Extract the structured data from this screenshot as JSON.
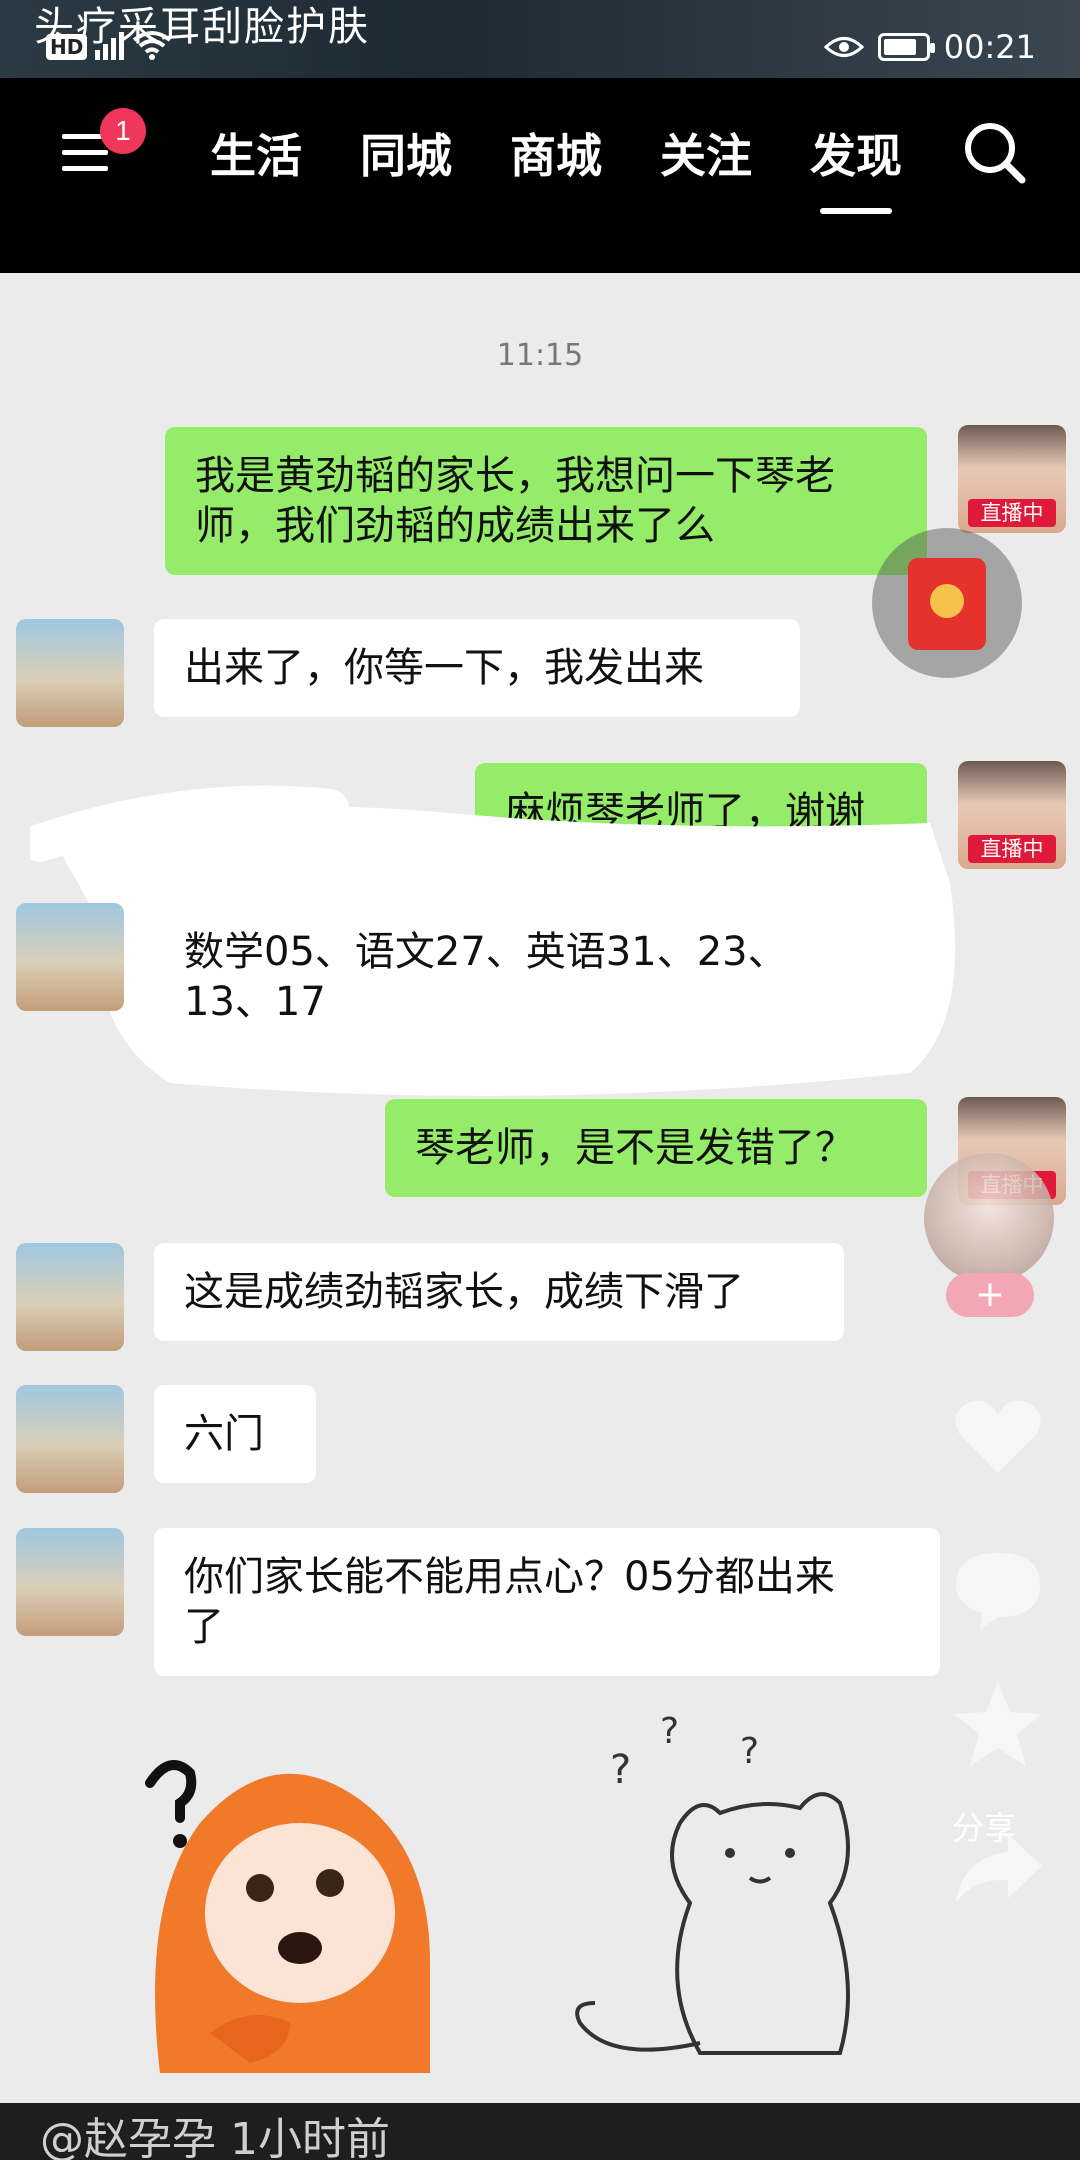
{
  "status_bar": {
    "caption": "头疗采耳刮脸护肤",
    "network": "HD",
    "time": "00:21",
    "icons": [
      "signal-icon",
      "wifi-icon",
      "eye-icon",
      "battery-icon"
    ]
  },
  "nav": {
    "menu_badge": "1",
    "tabs": [
      {
        "label": "生活"
      },
      {
        "label": "同城"
      },
      {
        "label": "商城"
      },
      {
        "label": "关注"
      },
      {
        "label": "发现"
      }
    ],
    "active_tab": "发现"
  },
  "chat": {
    "timestamp": "11:15",
    "live_tag": "直播中",
    "messages": [
      {
        "side": "me",
        "text_lines": [
          "我是黄劲韬的家长，我想问一下琴老",
          "师，我们劲韬的成绩出来了么"
        ]
      },
      {
        "side": "other",
        "text_lines": [
          "出来了，你等一下，我发出来"
        ]
      },
      {
        "side": "me",
        "text_lines": [
          "麻烦琴老师了，谢谢"
        ]
      },
      {
        "side": "other",
        "text_lines": [
          "数学05、语文27、英语31、23、",
          "13、17"
        ]
      },
      {
        "side": "me",
        "text_lines": [
          "琴老师，是不是发错了？"
        ]
      },
      {
        "side": "other",
        "text_lines": [
          "这是成绩劲韬家长，成绩下滑了"
        ]
      },
      {
        "side": "other",
        "text_lines": [
          "六门"
        ]
      },
      {
        "side": "other",
        "text_lines": [
          "你们家长能不能用点心？05分都出来",
          "了"
        ]
      }
    ]
  },
  "overlay": {
    "plus_label": "+",
    "share_label": "分享"
  },
  "bottom": {
    "text": "@赵孕孕 1小时前"
  },
  "colors": {
    "my_bubble": "#95ec69",
    "their_bubble": "#ffffff",
    "live_tag": "#e0193a",
    "badge": "#f0365a"
  }
}
